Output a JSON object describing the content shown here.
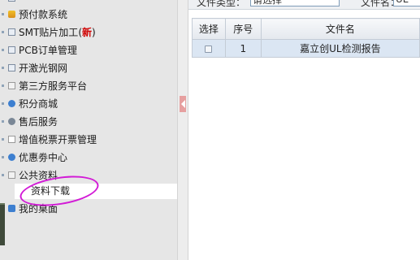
{
  "sidebar": {
    "items": [
      {
        "label": "预付款系统",
        "icon": "coin-icon"
      },
      {
        "label": "SMT贴片加工",
        "new_tag": "新",
        "icon": "chip-icon"
      },
      {
        "label": "PCB订单管理",
        "icon": "board-icon"
      },
      {
        "label": "开激光钢网",
        "icon": "stencil-icon"
      },
      {
        "label": "第三方服务平台",
        "icon": "service-icon"
      },
      {
        "label": "积分商城",
        "icon": "points-icon"
      },
      {
        "label": "售后服务",
        "icon": "aftersales-icon"
      },
      {
        "label": "增值税票开票管理",
        "icon": "invoice-icon"
      },
      {
        "label": "优惠劵中心",
        "icon": "coupon-icon"
      },
      {
        "label": "公共资料",
        "icon": "folder-icon"
      },
      {
        "label": "我的桌面",
        "icon": "desktop-icon"
      }
    ],
    "sub_item": "资料下载",
    "paren_open": "(",
    "paren_close": ")"
  },
  "filter": {
    "type_label": "文件类型：",
    "type_value": "请选择",
    "name_label": "文件名：",
    "name_value": "UL"
  },
  "table": {
    "headers": {
      "select": "选择",
      "index": "序号",
      "filename": "文件名"
    },
    "rows": [
      {
        "index": "1",
        "filename": "嘉立创UL检测报告"
      }
    ]
  },
  "colors": {
    "highlight_oval": "#d21bd6",
    "row_selected": "#dbe6f3",
    "new_tag": "#d00000"
  }
}
